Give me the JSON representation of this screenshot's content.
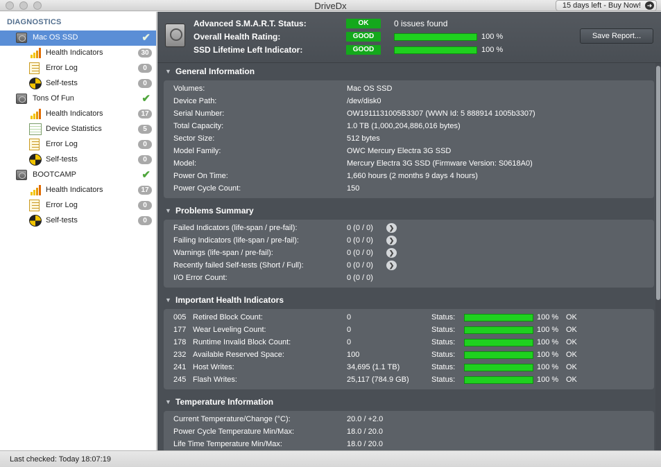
{
  "window": {
    "title": "DriveDx",
    "buy_label": "15 days left - Buy Now!"
  },
  "sidebar": {
    "header": "DIAGNOSTICS",
    "disks": [
      {
        "label": "Mac OS SSD",
        "selected": true,
        "items": [
          {
            "label": "Health Indicators",
            "count": "30",
            "icon": "health-bars-icon"
          },
          {
            "label": "Error Log",
            "count": "0",
            "icon": "error-log-icon"
          },
          {
            "label": "Self-tests",
            "count": "0",
            "icon": "self-tests-icon"
          }
        ]
      },
      {
        "label": "Tons Of Fun",
        "selected": false,
        "items": [
          {
            "label": "Health Indicators",
            "count": "17",
            "icon": "health-bars-icon"
          },
          {
            "label": "Device Statistics",
            "count": "5",
            "icon": "device-statistics-icon"
          },
          {
            "label": "Error Log",
            "count": "0",
            "icon": "error-log-icon"
          },
          {
            "label": "Self-tests",
            "count": "0",
            "icon": "self-tests-icon"
          }
        ]
      },
      {
        "label": "BOOTCAMP",
        "selected": false,
        "items": [
          {
            "label": "Health Indicators",
            "count": "17",
            "icon": "health-bars-icon"
          },
          {
            "label": "Error Log",
            "count": "0",
            "icon": "error-log-icon"
          },
          {
            "label": "Self-tests",
            "count": "0",
            "icon": "self-tests-icon"
          }
        ]
      }
    ]
  },
  "summary": {
    "smart_label": "Advanced S.M.A.R.T. Status:",
    "smart_badge": "OK",
    "smart_text": "0 issues found",
    "health_label": "Overall Health Rating:",
    "health_badge": "GOOD",
    "health_pct": "100 %",
    "health_fill": 1.0,
    "lifetime_label": "SSD Lifetime Left Indicator:",
    "lifetime_badge": "GOOD",
    "lifetime_pct": "100 %",
    "lifetime_fill": 1.0,
    "save_label": "Save Report..."
  },
  "general": {
    "title": "General Information",
    "rows": [
      {
        "label": "Volumes:",
        "value": "Mac OS SSD"
      },
      {
        "label": "Device Path:",
        "value": "/dev/disk0"
      },
      {
        "label": "Serial Number:",
        "value": "OW1911131005B3307 (WWN Id: 5 888914 1005b3307)"
      },
      {
        "label": "Total Capacity:",
        "value": "1.0 TB (1,000,204,886,016 bytes)"
      },
      {
        "label": "Sector Size:",
        "value": "512 bytes"
      },
      {
        "label": "Model Family:",
        "value": "OWC Mercury Electra 3G SSD"
      },
      {
        "label": "Model:",
        "value": "Mercury Electra 3G SSD  (Firmware Version: S0618A0)"
      },
      {
        "label": "Power On Time:",
        "value": "1,660 hours (2 months 9 days 4 hours)"
      },
      {
        "label": "Power Cycle Count:",
        "value": "150"
      }
    ]
  },
  "problems": {
    "title": "Problems Summary",
    "rows": [
      {
        "label": "Failed Indicators (life-span / pre-fail):",
        "value": "0 (0 / 0)",
        "link": true
      },
      {
        "label": "Failing Indicators (life-span / pre-fail):",
        "value": "0 (0 / 0)",
        "link": true
      },
      {
        "label": "Warnings (life-span / pre-fail):",
        "value": "0 (0 / 0)",
        "link": true
      },
      {
        "label": "Recently failed Self-tests (Short / Full):",
        "value": "0 (0 / 0)",
        "link": true
      },
      {
        "label": "I/O Error Count:",
        "value": "0 (0 / 0)",
        "link": false
      }
    ]
  },
  "health": {
    "title": "Important Health Indicators",
    "status_label": "Status:",
    "rows": [
      {
        "id": "005",
        "label": "Retired Block Count:",
        "value": "0",
        "pct": "100 %",
        "fill": 1.0,
        "state": "OK"
      },
      {
        "id": "177",
        "label": "Wear Leveling Count:",
        "value": "0",
        "pct": "100 %",
        "fill": 1.0,
        "state": "OK"
      },
      {
        "id": "178",
        "label": "Runtime Invalid Block Count:",
        "value": "0",
        "pct": "100 %",
        "fill": 1.0,
        "state": "OK"
      },
      {
        "id": "232",
        "label": "Available Reserved Space:",
        "value": "100",
        "pct": "100 %",
        "fill": 1.0,
        "state": "OK"
      },
      {
        "id": "241",
        "label": "Host Writes:",
        "value": "34,695 (1.1 TB)",
        "pct": "100 %",
        "fill": 1.0,
        "state": "OK"
      },
      {
        "id": "245",
        "label": "Flash Writes:",
        "value": "25,117 (784.9 GB)",
        "pct": "100 %",
        "fill": 1.0,
        "state": "OK"
      }
    ]
  },
  "temperature": {
    "title": "Temperature Information",
    "rows": [
      {
        "label": "Current Temperature/Change (°C):",
        "value": "20.0 / +2.0"
      },
      {
        "label": "Power Cycle Temperature Min/Max:",
        "value": "18.0 / 20.0"
      },
      {
        "label": "Life Time Temperature Min/Max:",
        "value": "18.0 / 20.0"
      }
    ]
  },
  "status_bar": {
    "text": "Last checked: Today 18:07:19"
  },
  "colors": {
    "accent": "#5a8ed6",
    "good": "#14a81c",
    "bar": "#1fd11f"
  }
}
